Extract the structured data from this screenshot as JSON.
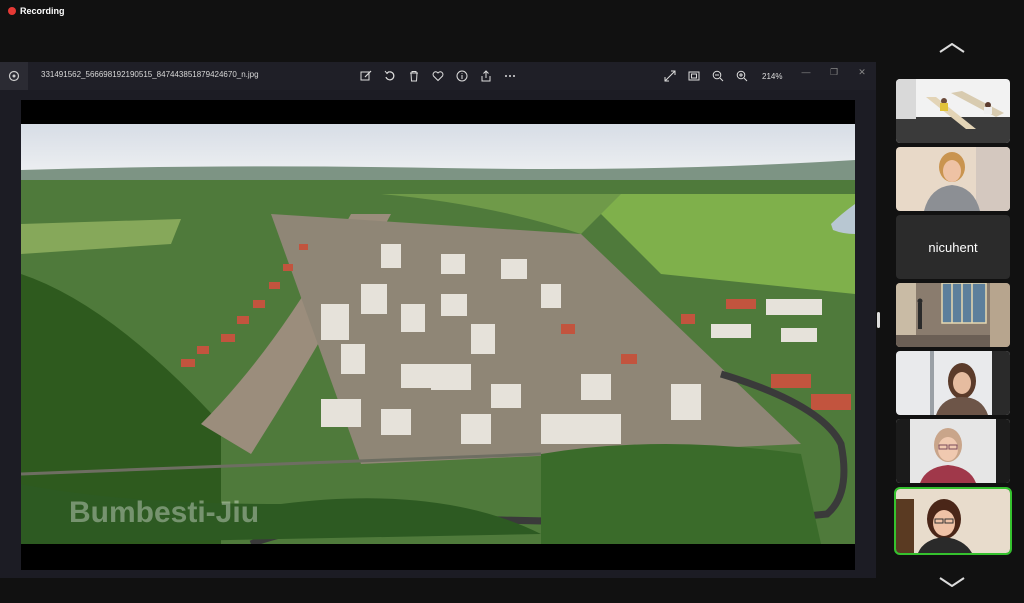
{
  "top": {
    "recording_label": "Recording"
  },
  "viewer": {
    "filename": "331491562_566698192190515_847443851879424670_n.jpg",
    "zoom_label": "214%",
    "toolbar_icons": [
      "edit-icon",
      "rotate-icon",
      "delete-icon",
      "favorite-icon",
      "info-icon",
      "share-icon",
      "more-icon"
    ],
    "view_icons": [
      "fullscreen-icon",
      "fit-screen-icon",
      "zoom-out-icon",
      "zoom-in-icon"
    ],
    "window_controls": [
      "minimize-icon",
      "restore-icon",
      "close-icon"
    ]
  },
  "photo": {
    "watermark": "Bumbesti-Jiu"
  },
  "participants": [
    {
      "type": "video",
      "scene": "classroom"
    },
    {
      "type": "video",
      "scene": "woman-blonde"
    },
    {
      "type": "name",
      "name": "nicuhent"
    },
    {
      "type": "video",
      "scene": "hallway"
    },
    {
      "type": "video",
      "scene": "woman-office"
    },
    {
      "type": "video",
      "scene": "woman-glasses"
    },
    {
      "type": "video",
      "scene": "woman-speaking",
      "active": true
    }
  ],
  "colors": {
    "accent_active": "#35c22e",
    "recording_dot": "#e53935"
  }
}
